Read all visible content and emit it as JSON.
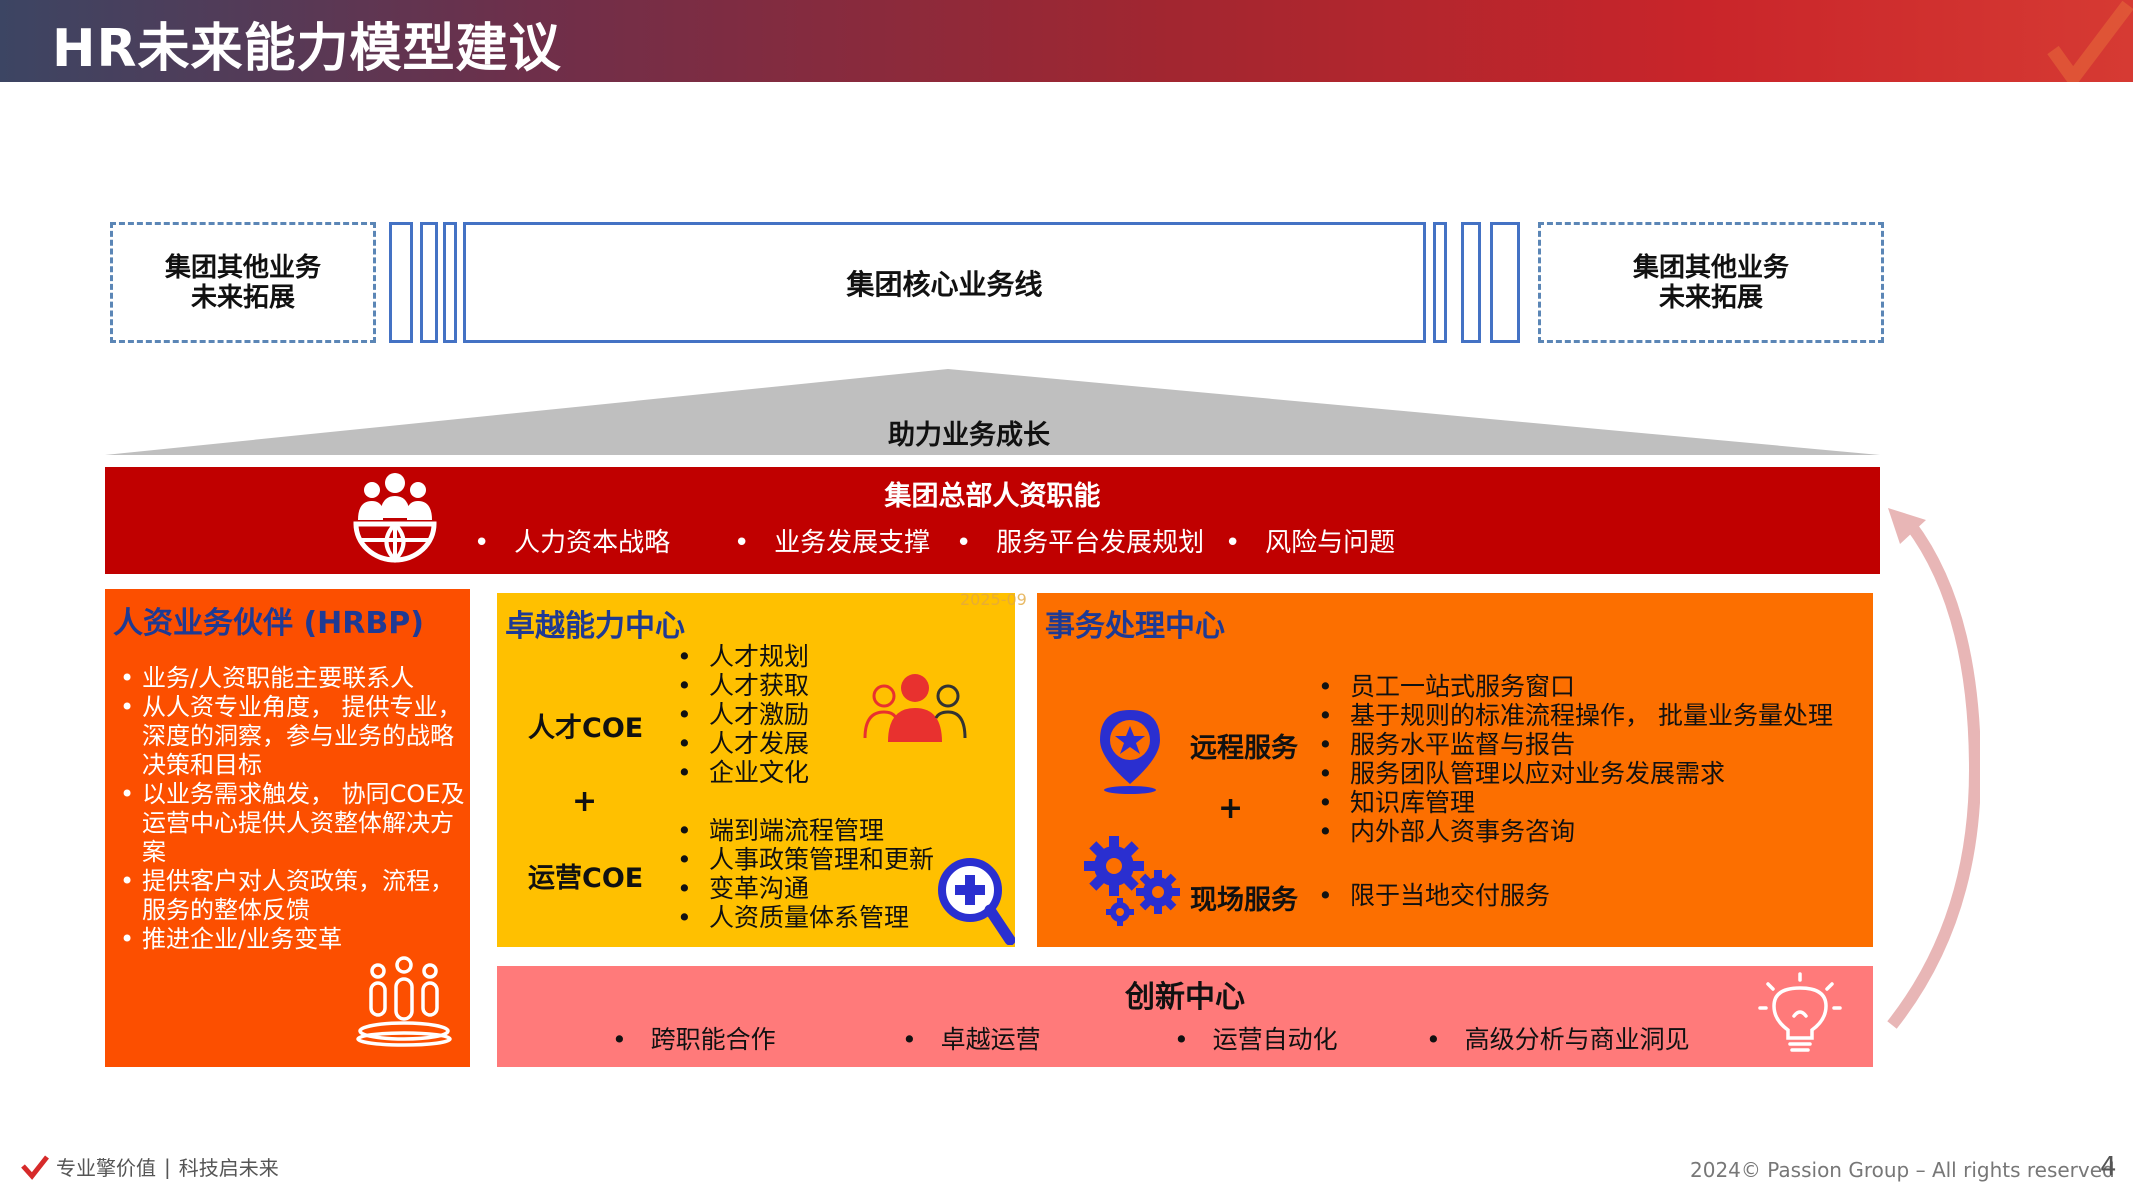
{
  "header": {
    "title": "HR未来能力模型建议"
  },
  "top_row": {
    "left_box": [
      "集团其他业务",
      "未来拓展"
    ],
    "core": "集团核心业务线",
    "right_box": [
      "集团其他业务",
      "未来拓展"
    ]
  },
  "growth_label": "助力业务成长",
  "hq": {
    "title": "集团总部人资职能",
    "items": [
      "人力资本战略",
      "业务发展支撑",
      "服务平台发展规划",
      "风险与问题"
    ]
  },
  "hrbp": {
    "title": "人资业务伙伴 (HRBP)",
    "items": [
      "业务/人资职能主要联系人",
      "从人资专业角度， 提供专业，深度的洞察，参与业务的战略决策和目标",
      "以业务需求触发， 协同COE及运营中心提供人资整体解决方案",
      "提供客户对人资政策，流程，服务的整体反馈",
      "推进企业/业务变革"
    ]
  },
  "coe": {
    "title": "卓越能力中心",
    "talent_label": "人才COE",
    "talent_items": [
      "人才规划",
      "人才获取",
      "人才激励",
      "人才发展",
      "企业文化"
    ],
    "plus": "+",
    "ops_label": "运营COE",
    "ops_items": [
      "端到端流程管理",
      "人事政策管理和更新",
      "变革沟通",
      "人资质量体系管理"
    ]
  },
  "service": {
    "title": "事务处理中心",
    "remote_label": "远程服务",
    "remote_items": [
      "员工一站式服务窗口",
      "基于规则的标准流程操作， 批量业务量处理",
      "服务水平监督与报告",
      "服务团队管理以应对业务发展需求",
      "知识库管理",
      "内外部人资事务咨询"
    ],
    "plus": "+",
    "onsite_label": "现场服务",
    "onsite_items": [
      "限于当地交付服务"
    ]
  },
  "innovation": {
    "title": "创新中心",
    "items": [
      "跨职能合作",
      "卓越运营",
      "运营自动化",
      "高级分析与商业洞见"
    ]
  },
  "watermark": "2025-09",
  "footer": {
    "slogan_left": "专业擎价值",
    "separator": "|",
    "slogan_right": "科技启未来",
    "copyright": "2024© Passion Group – All rights reserved",
    "page": "4"
  },
  "colors": {
    "hq": "#c00000",
    "hrbp": "#fc4f00",
    "coe": "#ffc000",
    "service": "#fc6f00",
    "innovation": "#ff7a7a",
    "title_blue": "#1f3a93"
  }
}
